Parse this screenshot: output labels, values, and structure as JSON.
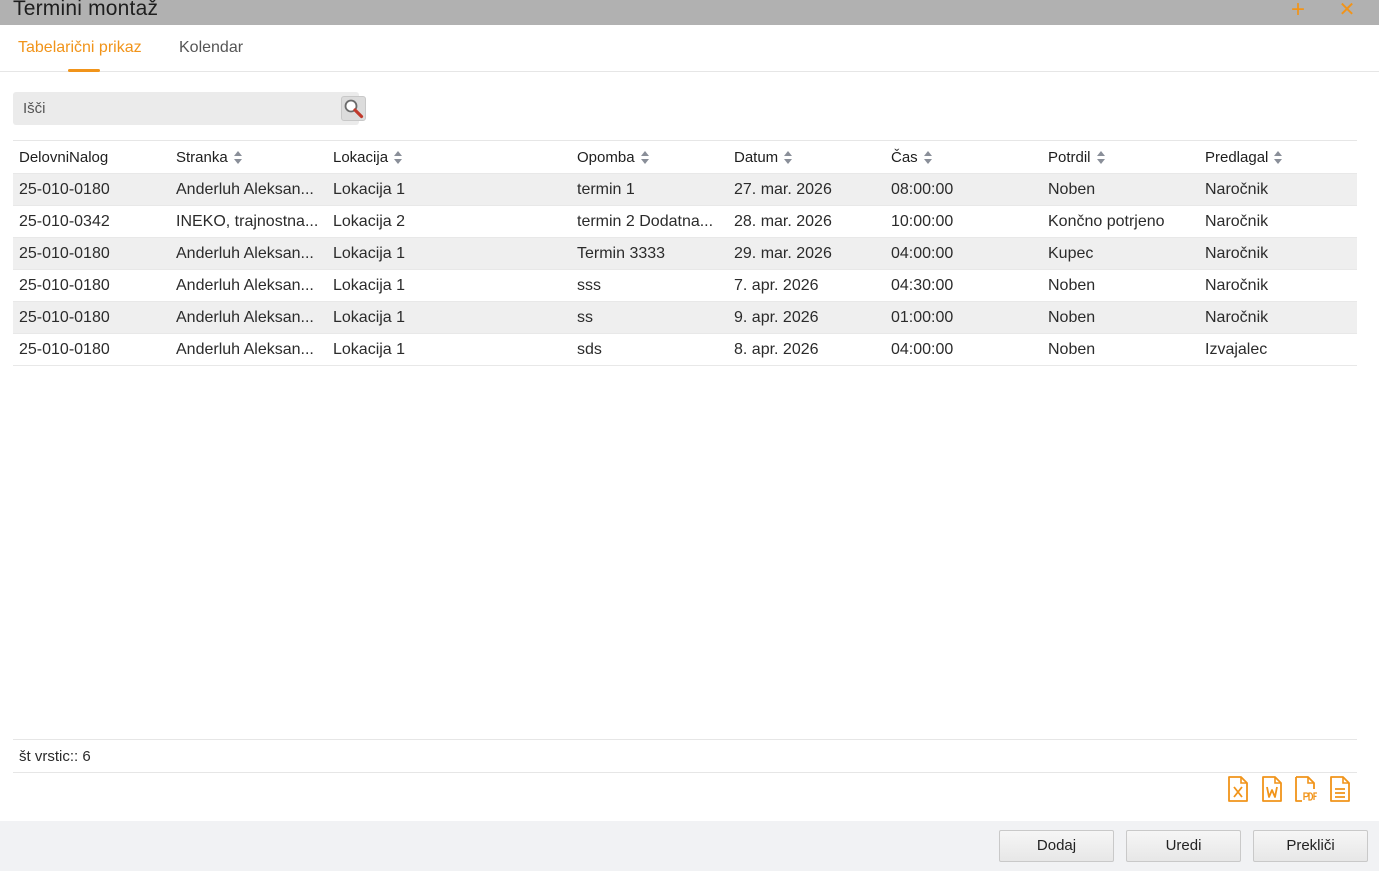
{
  "window": {
    "title": "Termini montaž"
  },
  "tabs": [
    {
      "label": "Tabelarični prikaz",
      "active": true
    },
    {
      "label": "Kolendar",
      "active": false
    }
  ],
  "search": {
    "placeholder": "Išči",
    "value": ""
  },
  "table": {
    "columns": [
      "DelovniNalog",
      "Stranka",
      "Lokacija",
      "Opomba",
      "Datum",
      "Čas",
      "Potrdil",
      "Predlagal"
    ],
    "rows": [
      [
        "25-010-0180",
        "Anderluh Aleksan...",
        "Lokacija 1",
        "termin 1",
        "27. mar. 2026",
        "08:00:00",
        "Noben",
        "Naročnik"
      ],
      [
        "25-010-0342",
        "INEKO, trajnostna...",
        "Lokacija 2",
        "termin 2 Dodatna...",
        "28. mar. 2026",
        "10:00:00",
        "Končno potrjeno",
        "Naročnik"
      ],
      [
        "25-010-0180",
        "Anderluh Aleksan...",
        "Lokacija 1",
        "Termin 3333",
        "29. mar. 2026",
        "04:00:00",
        "Kupec",
        "Naročnik"
      ],
      [
        "25-010-0180",
        "Anderluh Aleksan...",
        "Lokacija 1",
        "sss",
        "7. apr. 2026",
        "04:30:00",
        "Noben",
        "Naročnik"
      ],
      [
        "25-010-0180",
        "Anderluh Aleksan...",
        "Lokacija 1",
        "ss",
        "9. apr. 2026",
        "01:00:00",
        "Noben",
        "Naročnik"
      ],
      [
        "25-010-0180",
        "Anderluh Aleksan...",
        "Lokacija 1",
        "sds",
        "8. apr. 2026",
        "04:00:00",
        "Noben",
        "Izvajalec"
      ]
    ]
  },
  "footer": {
    "row_count": "št vrstic:: 6"
  },
  "exports": [
    "excel-export-icon",
    "word-export-icon",
    "pdf-export-icon",
    "text-export-icon"
  ],
  "buttons": {
    "add": "Dodaj",
    "edit": "Uredi",
    "cancel": "Prekliči"
  },
  "colors": {
    "accent": "#f1941a",
    "titlebar": "#b1b1b1",
    "row_alt": "#efefef"
  }
}
